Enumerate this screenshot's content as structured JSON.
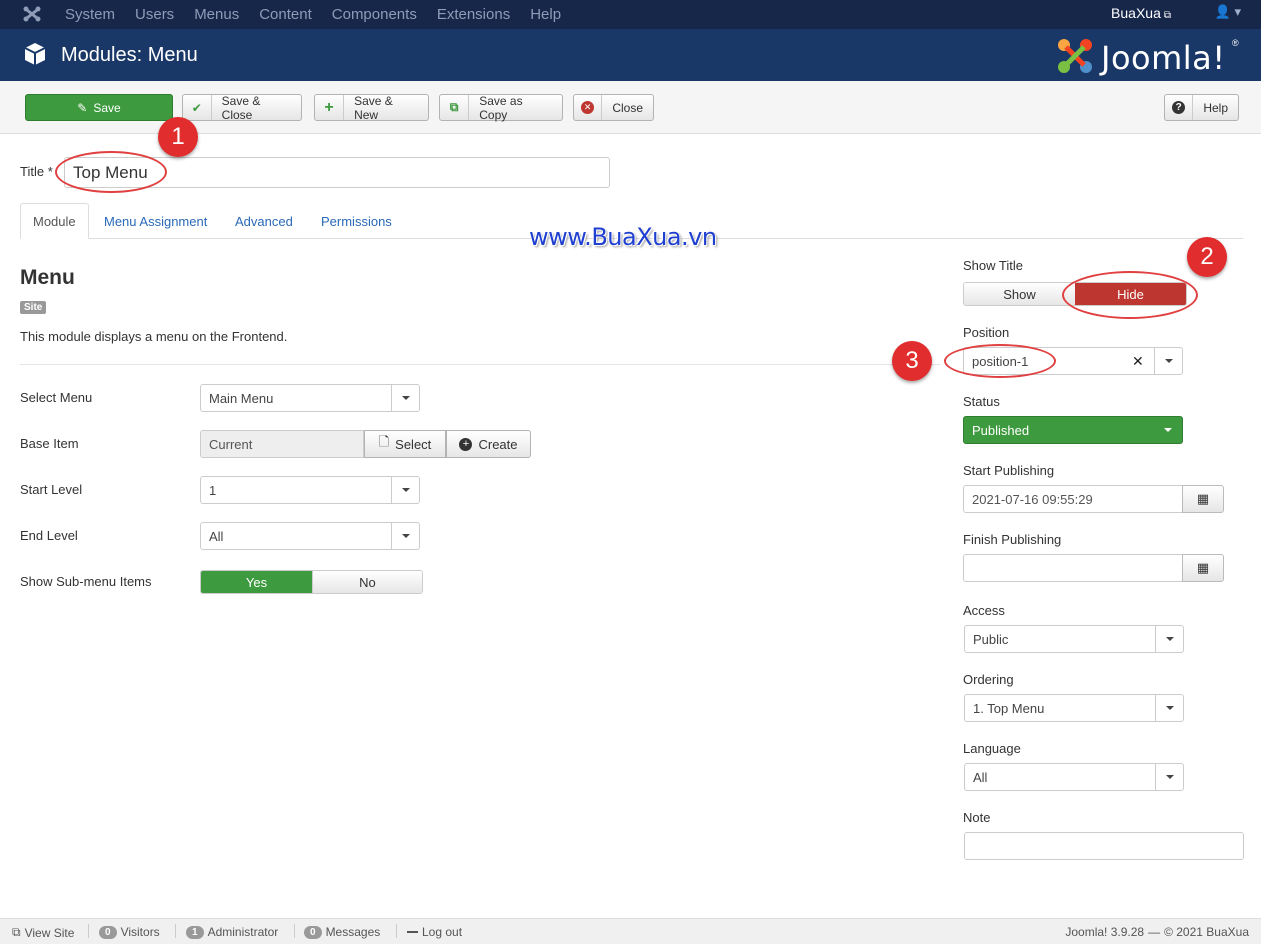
{
  "topnav": {
    "menu": [
      "System",
      "Users",
      "Menus",
      "Content",
      "Components",
      "Extensions",
      "Help"
    ],
    "site_name": "BuaXua"
  },
  "header": {
    "title": "Modules: Menu",
    "brand": "Joomla!"
  },
  "toolbar": {
    "save": "Save",
    "save_close": "Save & Close",
    "save_new": "Save & New",
    "save_copy": "Save as Copy",
    "close": "Close",
    "help": "Help"
  },
  "form": {
    "title_label": "Title *",
    "title_value": "Top Menu",
    "tabs": [
      "Module",
      "Menu Assignment",
      "Advanced",
      "Permissions"
    ],
    "heading": "Menu",
    "site_badge": "Site",
    "description": "This module displays a menu on the Frontend.",
    "select_menu_label": "Select Menu",
    "select_menu_value": "Main Menu",
    "base_item_label": "Base Item",
    "base_item_value": "Current",
    "select_btn": "Select",
    "create_btn": "Create",
    "start_level_label": "Start Level",
    "start_level_value": "1",
    "end_level_label": "End Level",
    "end_level_value": "All",
    "submenu_label": "Show Sub-menu Items",
    "submenu_yes": "Yes",
    "submenu_no": "No"
  },
  "watermark": "www.BuaXua.vn",
  "annotations": [
    "1",
    "2",
    "3"
  ],
  "sidebar": {
    "show_title_label": "Show Title",
    "show": "Show",
    "hide": "Hide",
    "position_label": "Position",
    "position_value": "position-1",
    "status_label": "Status",
    "status_value": "Published",
    "start_pub_label": "Start Publishing",
    "start_pub_value": "2021-07-16 09:55:29",
    "finish_pub_label": "Finish Publishing",
    "access_label": "Access",
    "access_value": "Public",
    "ordering_label": "Ordering",
    "ordering_value": "1. Top Menu",
    "language_label": "Language",
    "language_value": "All",
    "note_label": "Note"
  },
  "footer": {
    "view_site": "View Site",
    "visitors_count": "0",
    "visitors": "Visitors",
    "admin_count": "1",
    "admin": "Administrator",
    "messages_count": "0",
    "messages": "Messages",
    "logout": "Log out",
    "version": "Joomla! 3.9.28",
    "copyright": "© 2021 BuaXua"
  },
  "colors": {
    "nav": "#17274a",
    "header": "#1a3867",
    "green": "#3e9a3e",
    "red": "#bd362f",
    "annotation": "#e12d2d"
  }
}
